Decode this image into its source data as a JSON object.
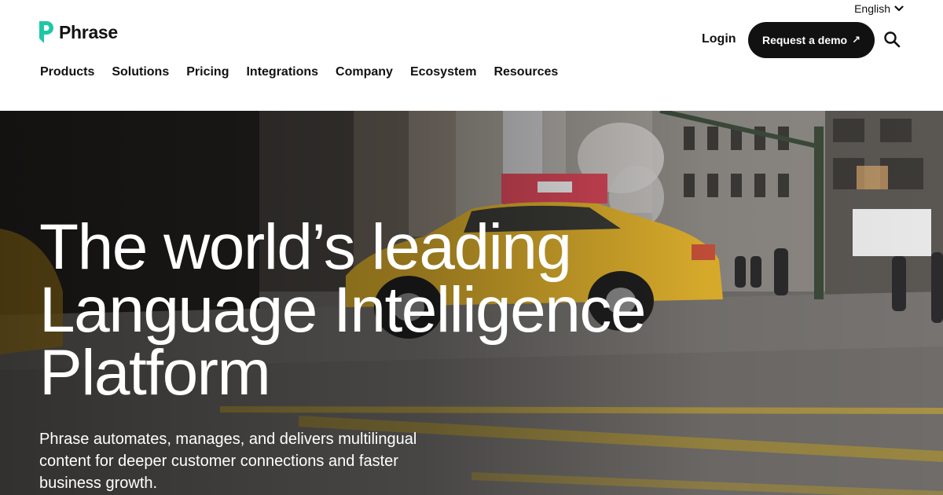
{
  "header": {
    "language": "English",
    "language_icon": "chevron-down-icon",
    "logo_text": "Phrase",
    "brand_color": "#1fc7a5",
    "nav": [
      "Products",
      "Solutions",
      "Pricing",
      "Integrations",
      "Company",
      "Ecosystem",
      "Resources"
    ],
    "login": "Login",
    "demo_button": "Request a demo",
    "demo_arrow": "↗",
    "search_icon": "search-icon"
  },
  "hero": {
    "title_lines": [
      "The world’s leading",
      "Language Intelligence",
      "Platform"
    ],
    "subtitle": "Phrase automates, manages, and delivers multilingual content for deeper customer connections and faster business growth.",
    "background": "city street with yellow taxi"
  }
}
